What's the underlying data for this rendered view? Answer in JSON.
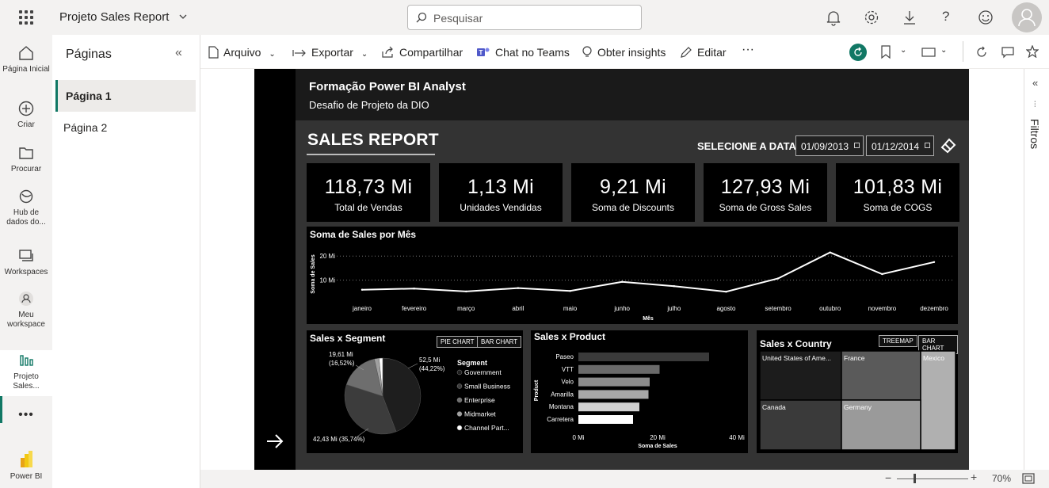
{
  "app": {
    "title": "Projeto Sales Report",
    "search_placeholder": "Pesquisar"
  },
  "leftnav": [
    {
      "label": "Página Inicial",
      "icon": "home-icon"
    },
    {
      "label": "Criar",
      "icon": "plus-circle-icon"
    },
    {
      "label": "Procurar",
      "icon": "folder-icon"
    },
    {
      "label": "Hub de dados do...",
      "icon": "data-hub-icon"
    },
    {
      "label": "Workspaces",
      "icon": "workspaces-icon"
    },
    {
      "label": "Meu workspace",
      "icon": "person-icon"
    },
    {
      "label": "Projeto Sales...",
      "icon": "report-icon"
    },
    {
      "label": "Power BI",
      "icon": "powerbi-logo"
    }
  ],
  "pages": {
    "title": "Páginas",
    "items": [
      "Página 1",
      "Página 2"
    ],
    "active": "Página 1"
  },
  "toolbar": {
    "arquivo": "Arquivo",
    "exportar": "Exportar",
    "compartilhar": "Compartilhar",
    "teams": "Chat no Teams",
    "insights": "Obter insights",
    "editar": "Editar",
    "more": "···"
  },
  "report": {
    "header_title": "Formação Power BI Analyst",
    "header_subtitle": "Desafio de Projeto da DIO",
    "title": "SALES REPORT",
    "date_label": "SELECIONE A DATA",
    "date_start": "01/09/2013",
    "date_end": "01/12/2014",
    "kpis": [
      {
        "value": "118,73 Mi",
        "label": "Total de Vendas"
      },
      {
        "value": "1,13 Mi",
        "label": "Unidades Vendidas"
      },
      {
        "value": "9,21 Mi",
        "label": "Soma de Discounts"
      },
      {
        "value": "127,93 Mi",
        "label": "Soma de Gross Sales"
      },
      {
        "value": "101,83 Mi",
        "label": "Soma de COGS"
      }
    ],
    "segment_title": "Sales x Segment",
    "segment_btn_pie": "PIE CHART",
    "segment_btn_bar": "BAR CHART",
    "product_title": "Sales x Product",
    "country_title": "Sales x Country",
    "country_btn_treemap": "TREEMAP",
    "country_btn_bar": "BAR CHART"
  },
  "chart_data": [
    {
      "type": "line",
      "title": "Soma de Sales por Mês",
      "xlabel": "Mês",
      "ylabel": "Soma de Sales",
      "categories": [
        "janeiro",
        "fevereiro",
        "março",
        "abril",
        "maio",
        "junho",
        "julho",
        "agosto",
        "setembro",
        "outubro",
        "novembro",
        "dezembro"
      ],
      "values": [
        6.0,
        6.5,
        5.3,
        6.7,
        5.5,
        9.3,
        7.5,
        5.2,
        10.7,
        21.5,
        12.5,
        17.5
      ],
      "yticks": [
        "10 Mi",
        "20 Mi"
      ],
      "ytick_values": [
        10,
        20
      ],
      "ylim": [
        0,
        25
      ]
    },
    {
      "type": "pie",
      "title": "Sales x Segment",
      "legend_title": "Segment",
      "labels": [
        "Government",
        "Small Business",
        "Enterprise",
        "Midmarket",
        "Channel Part..."
      ],
      "values": [
        52.5,
        42.43,
        19.61,
        2.4,
        1.8
      ],
      "colors": [
        "#1e1e1e",
        "#3c3c3c",
        "#6e6e6e",
        "#a0a0a0",
        "#ffffff"
      ],
      "data_labels": [
        "52,5 Mi (44,22%)",
        "42,43 Mi (35,74%)",
        "19,61 Mi (16,52%)"
      ]
    },
    {
      "type": "bar",
      "title": "Sales x Product",
      "xlabel": "Soma de Sales",
      "ylabel": "Product",
      "categories": [
        "Paseo",
        "VTT",
        "Velo",
        "Amarilla",
        "Montana",
        "Carretera"
      ],
      "values": [
        33.0,
        20.5,
        18.0,
        17.7,
        15.4,
        13.8
      ],
      "xticks": [
        "0 Mi",
        "20 Mi",
        "40 Mi"
      ],
      "xtick_values": [
        0,
        20,
        40
      ],
      "xlim": [
        0,
        40
      ]
    },
    {
      "type": "treemap",
      "title": "Sales x Country",
      "labels": [
        "United States of Ame...",
        "France",
        "Mexico",
        "Canada",
        "Germany"
      ]
    }
  ],
  "status": {
    "zoom": "70%"
  }
}
